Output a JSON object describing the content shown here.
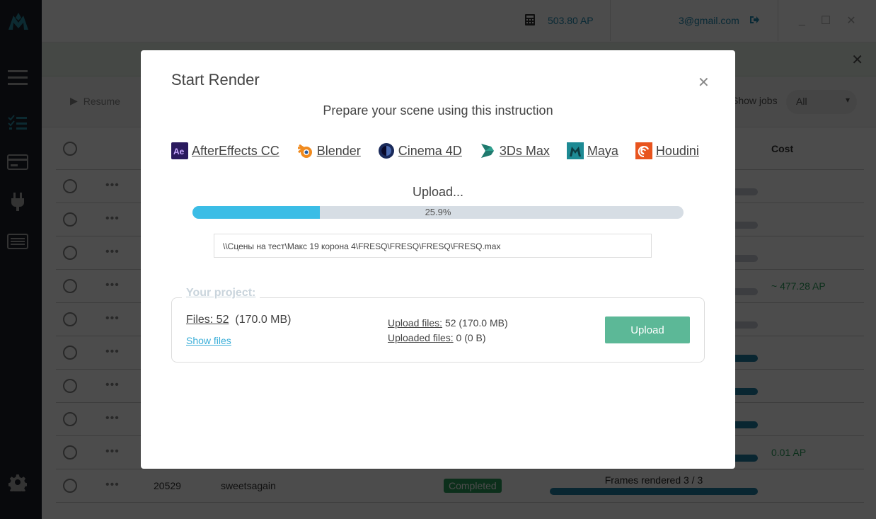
{
  "topbar": {
    "balance": "503.80 AP",
    "email": "3@gmail.com"
  },
  "toolbar": {
    "resume_label": "Resume",
    "show_jobs_label": "Show jobs",
    "show_jobs_value": "All"
  },
  "table": {
    "cost_header": "Cost",
    "rows": [
      {
        "id": "",
        "name": "",
        "status": "",
        "progress_label": "",
        "cost": ""
      },
      {
        "id": "",
        "name": "",
        "status": "",
        "progress_label": "",
        "cost": ""
      },
      {
        "id": "",
        "name": "",
        "status": "",
        "progress_label": "",
        "cost": ""
      },
      {
        "id": "",
        "name": "",
        "status": "",
        "progress_label": "",
        "cost": "~ 477.28 AP"
      },
      {
        "id": "",
        "name": "",
        "status": "",
        "progress_label": "",
        "cost": ""
      },
      {
        "id": "",
        "name": "",
        "status": "",
        "progress_label": "",
        "cost": ""
      },
      {
        "id": "",
        "name": "",
        "status": "",
        "progress_label": "",
        "cost": ""
      },
      {
        "id": "",
        "name": "",
        "status": "",
        "progress_label": "",
        "cost": ""
      },
      {
        "id": "",
        "name": "",
        "status": "",
        "progress_label": "",
        "cost": "0.01 AP"
      },
      {
        "id": "20529",
        "name": "sweetsagain",
        "status": "Completed",
        "progress_label": "Frames rendered 3 / 3",
        "cost": ""
      }
    ]
  },
  "modal": {
    "title": "Start Render",
    "subtitle": "Prepare your scene using this instruction",
    "apps": [
      {
        "label": "AfterEffects CC",
        "icon": "aftereffects-icon"
      },
      {
        "label": "Blender",
        "icon": "blender-icon"
      },
      {
        "label": "Cinema 4D",
        "icon": "cinema4d-icon"
      },
      {
        "label": "3Ds Max",
        "icon": "3dsmax-icon"
      },
      {
        "label": "Maya",
        "icon": "maya-icon"
      },
      {
        "label": "Houdini",
        "icon": "houdini-icon"
      }
    ],
    "upload_status": "Upload...",
    "progress_percent": 25.9,
    "progress_text": "25.9%",
    "scene_path": "\\\\Сцены на тест\\Макс 19 корона 4\\FRESQ\\FRESQ\\FRESQ\\FRESQ.max",
    "project": {
      "legend": "Your project:",
      "files_label": "Files: 52",
      "files_size": "(170.0 MB)",
      "show_files": "Show files",
      "upload_files_label": "Upload files:",
      "upload_files_value": "52 (170.0 MB)",
      "uploaded_files_label": "Uploaded files:",
      "uploaded_files_value": "0 (0 B)",
      "upload_button": "Upload"
    }
  },
  "colors": {
    "accent": "#3bbde6",
    "upload_button": "#5cb897",
    "sidebar": "#1d2028"
  }
}
